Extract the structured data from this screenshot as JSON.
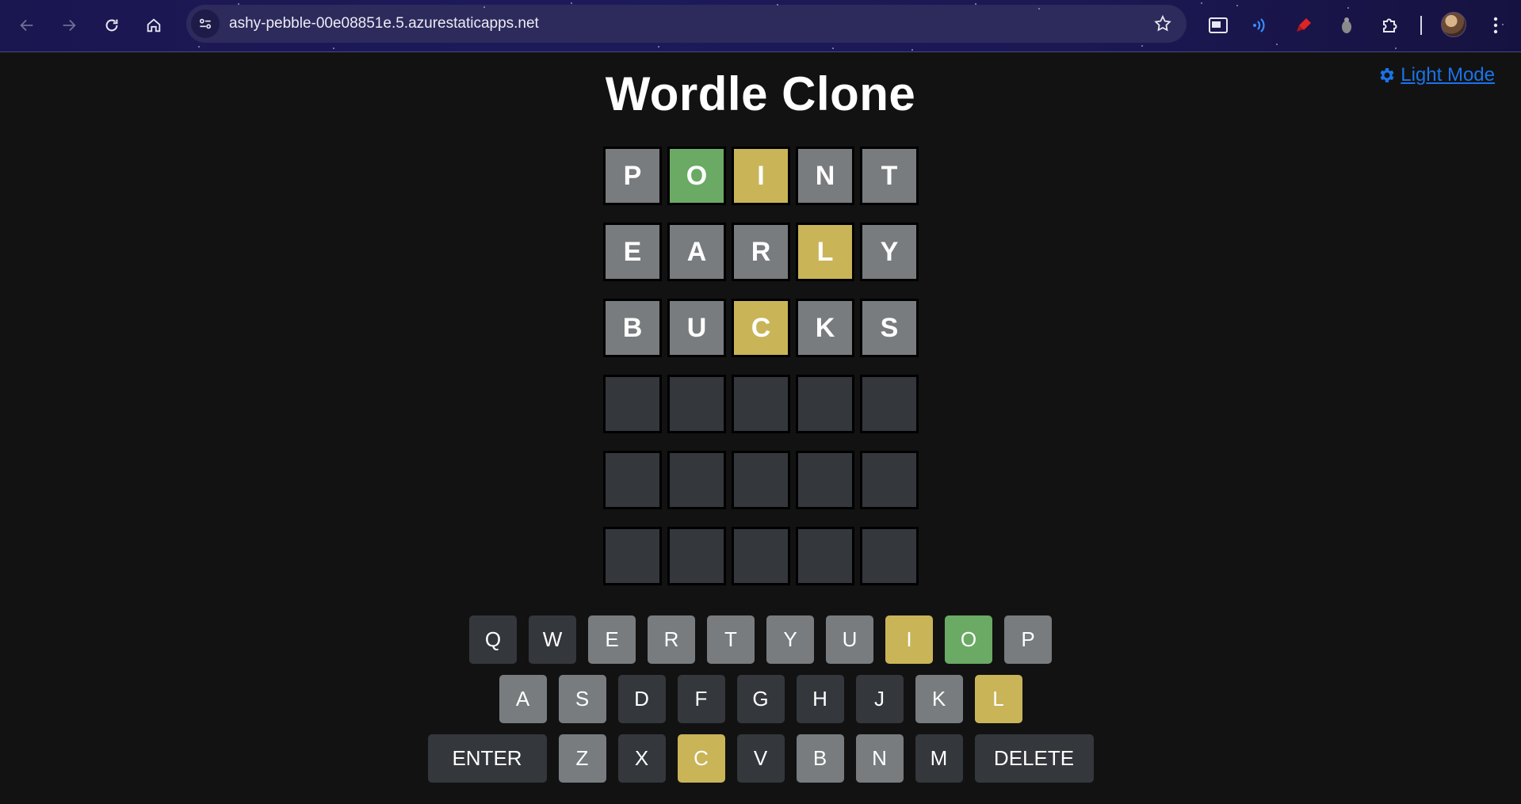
{
  "browser": {
    "url": "ashy-pebble-00e08851e.5.azurestaticapps.net"
  },
  "page": {
    "title": "Wordle Clone",
    "mode_toggle_label": " Light Mode"
  },
  "colors": {
    "correct": "#6aaa64",
    "present": "#c9b458",
    "absent": "#787c7e",
    "empty": "#34373b",
    "key_unused": "#34373b",
    "link": "#1a73e8"
  },
  "board": [
    [
      {
        "letter": "P",
        "state": "absent"
      },
      {
        "letter": "O",
        "state": "correct"
      },
      {
        "letter": "I",
        "state": "present"
      },
      {
        "letter": "N",
        "state": "absent"
      },
      {
        "letter": "T",
        "state": "absent"
      }
    ],
    [
      {
        "letter": "E",
        "state": "absent"
      },
      {
        "letter": "A",
        "state": "absent"
      },
      {
        "letter": "R",
        "state": "absent"
      },
      {
        "letter": "L",
        "state": "present"
      },
      {
        "letter": "Y",
        "state": "absent"
      }
    ],
    [
      {
        "letter": "B",
        "state": "absent"
      },
      {
        "letter": "U",
        "state": "absent"
      },
      {
        "letter": "C",
        "state": "present"
      },
      {
        "letter": "K",
        "state": "absent"
      },
      {
        "letter": "S",
        "state": "absent"
      }
    ],
    [
      {
        "letter": "",
        "state": "empty"
      },
      {
        "letter": "",
        "state": "empty"
      },
      {
        "letter": "",
        "state": "empty"
      },
      {
        "letter": "",
        "state": "empty"
      },
      {
        "letter": "",
        "state": "empty"
      }
    ],
    [
      {
        "letter": "",
        "state": "empty"
      },
      {
        "letter": "",
        "state": "empty"
      },
      {
        "letter": "",
        "state": "empty"
      },
      {
        "letter": "",
        "state": "empty"
      },
      {
        "letter": "",
        "state": "empty"
      }
    ],
    [
      {
        "letter": "",
        "state": "empty"
      },
      {
        "letter": "",
        "state": "empty"
      },
      {
        "letter": "",
        "state": "empty"
      },
      {
        "letter": "",
        "state": "empty"
      },
      {
        "letter": "",
        "state": "empty"
      }
    ]
  ],
  "keyboard": [
    [
      {
        "key": "Q",
        "state": "unused"
      },
      {
        "key": "W",
        "state": "unused"
      },
      {
        "key": "E",
        "state": "absent"
      },
      {
        "key": "R",
        "state": "absent"
      },
      {
        "key": "T",
        "state": "absent"
      },
      {
        "key": "Y",
        "state": "absent"
      },
      {
        "key": "U",
        "state": "absent"
      },
      {
        "key": "I",
        "state": "present"
      },
      {
        "key": "O",
        "state": "correct"
      },
      {
        "key": "P",
        "state": "absent"
      }
    ],
    [
      {
        "key": "A",
        "state": "absent"
      },
      {
        "key": "S",
        "state": "absent"
      },
      {
        "key": "D",
        "state": "unused"
      },
      {
        "key": "F",
        "state": "unused"
      },
      {
        "key": "G",
        "state": "unused"
      },
      {
        "key": "H",
        "state": "unused"
      },
      {
        "key": "J",
        "state": "unused"
      },
      {
        "key": "K",
        "state": "absent"
      },
      {
        "key": "L",
        "state": "present"
      }
    ],
    [
      {
        "key": "ENTER",
        "state": "unused",
        "wide": true
      },
      {
        "key": "Z",
        "state": "absent"
      },
      {
        "key": "X",
        "state": "unused"
      },
      {
        "key": "C",
        "state": "present"
      },
      {
        "key": "V",
        "state": "unused"
      },
      {
        "key": "B",
        "state": "absent"
      },
      {
        "key": "N",
        "state": "absent"
      },
      {
        "key": "M",
        "state": "unused"
      },
      {
        "key": "DELETE",
        "state": "unused",
        "wide": true
      }
    ]
  ],
  "icons": {
    "back": "arrow-left-icon",
    "forward": "arrow-right-icon",
    "reload": "reload-icon",
    "home": "home-icon",
    "site_info": "tune-icon",
    "bookmark": "star-icon",
    "mode": "gear-icon"
  }
}
